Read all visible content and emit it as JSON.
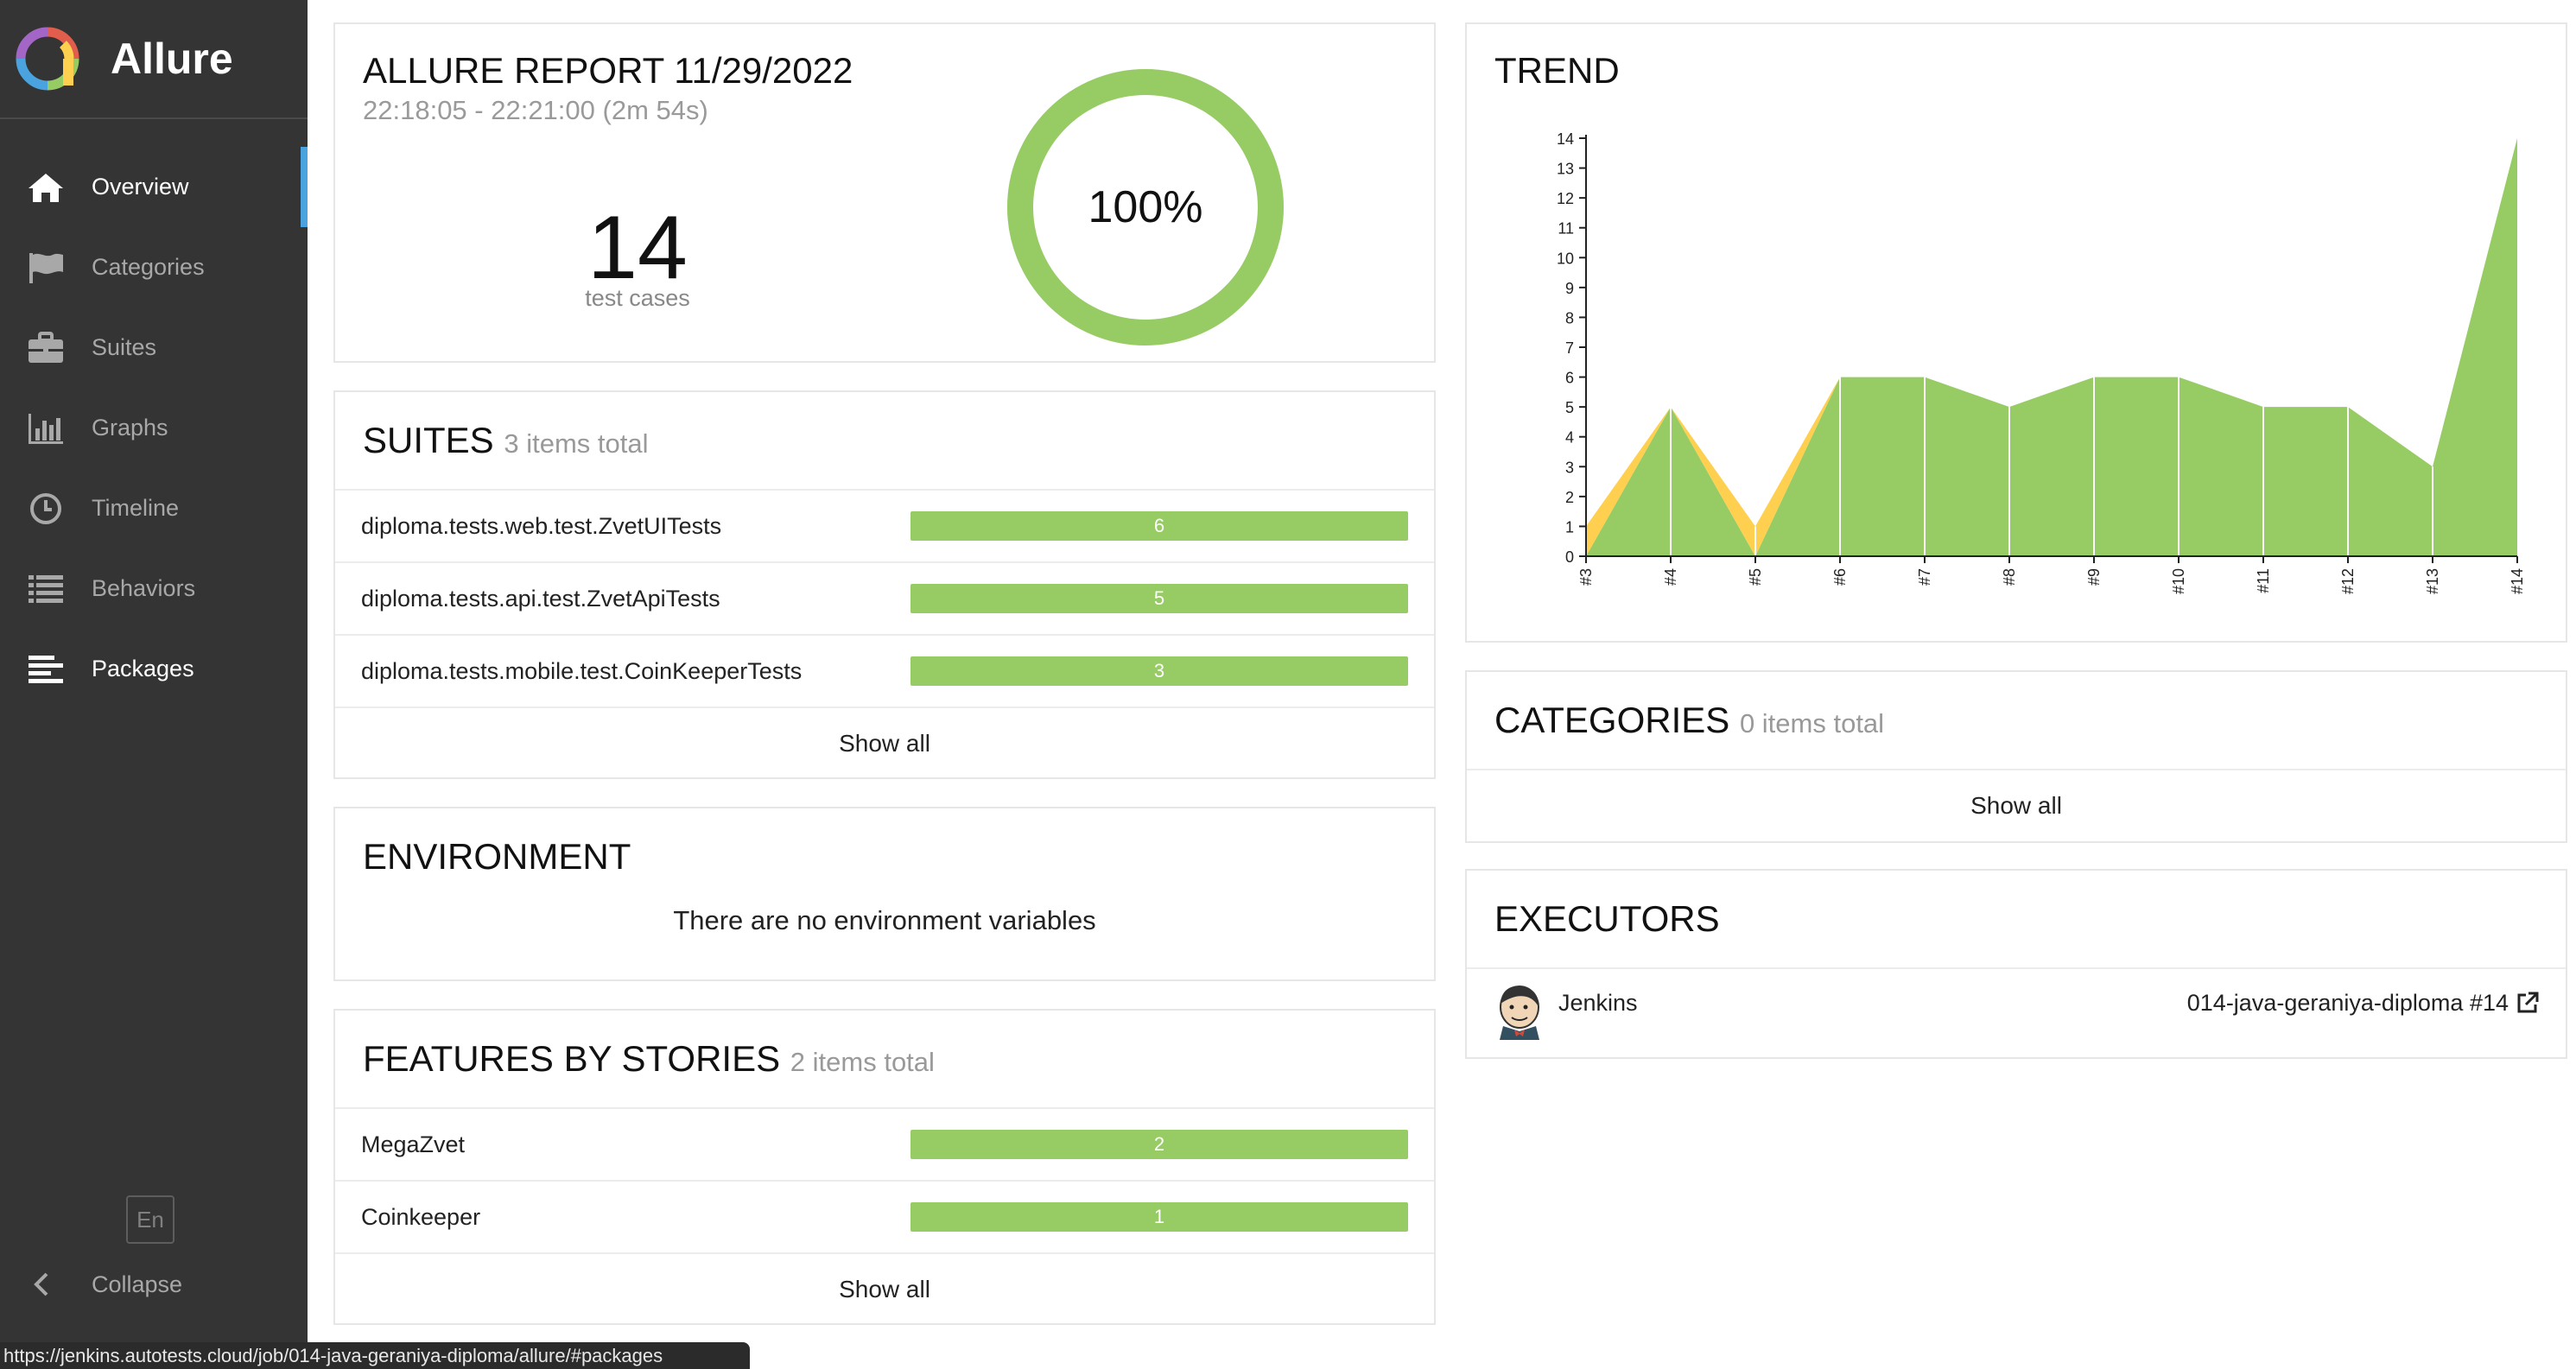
{
  "sidebar": {
    "brand": "Allure",
    "items": [
      {
        "label": "Overview",
        "icon": "home-icon"
      },
      {
        "label": "Categories",
        "icon": "flag-icon"
      },
      {
        "label": "Suites",
        "icon": "briefcase-icon"
      },
      {
        "label": "Graphs",
        "icon": "bar-chart-icon"
      },
      {
        "label": "Timeline",
        "icon": "clock-icon"
      },
      {
        "label": "Behaviors",
        "icon": "list-icon"
      },
      {
        "label": "Packages",
        "icon": "align-left-icon"
      }
    ],
    "language": "En",
    "collapse_label": "Collapse"
  },
  "summary": {
    "title": "ALLURE REPORT 11/29/2022",
    "time": "22:18:05 - 22:21:00 (2m 54s)",
    "count": "14",
    "count_label": "test cases",
    "percent": "100%",
    "passed_fraction": 1.0
  },
  "suites": {
    "title": "SUITES",
    "subtitle": "3 items total",
    "items": [
      {
        "name": "diploma.tests.web.test.ZvetUITests",
        "count": "6"
      },
      {
        "name": "diploma.tests.api.test.ZvetApiTests",
        "count": "5"
      },
      {
        "name": "diploma.tests.mobile.test.CoinKeeperTests",
        "count": "3"
      }
    ],
    "show_all": "Show all"
  },
  "environment": {
    "title": "ENVIRONMENT",
    "message": "There are no environment variables"
  },
  "features": {
    "title": "FEATURES BY STORIES",
    "subtitle": "2 items total",
    "items": [
      {
        "name": "MegaZvet",
        "count": "2"
      },
      {
        "name": "Coinkeeper",
        "count": "1"
      }
    ],
    "show_all": "Show all"
  },
  "trend": {
    "title": "TREND"
  },
  "chart_data": {
    "type": "area",
    "title": "",
    "x": [
      "#3",
      "#4",
      "#5",
      "#6",
      "#7",
      "#8",
      "#9",
      "#10",
      "#11",
      "#12",
      "#13",
      "#14"
    ],
    "series": [
      {
        "values": [
          0,
          5,
          0,
          6,
          6,
          5,
          6,
          6,
          5,
          5,
          3,
          14
        ],
        "color": "#97cc64"
      },
      {
        "values": [
          1,
          0,
          1,
          0,
          0,
          0,
          0,
          0,
          0,
          0,
          0,
          0
        ],
        "color": "#ffd050"
      }
    ],
    "stacked": true,
    "ylim": [
      0,
      14
    ],
    "yticks": [
      0,
      1,
      2,
      3,
      4,
      5,
      6,
      7,
      8,
      9,
      10,
      11,
      12,
      13,
      14
    ],
    "grid": false
  },
  "categories": {
    "title": "CATEGORIES",
    "subtitle": "0 items total",
    "show_all": "Show all"
  },
  "executors": {
    "title": "EXECUTORS",
    "name": "Jenkins",
    "build": "014-java-geraniya-diploma #14"
  },
  "status_url": "https://jenkins.autotests.cloud/job/014-java-geraniya-diploma/allure/#packages",
  "colors": {
    "sidebar_bg": "#343434",
    "passed": "#97cc64",
    "broken": "#ffd050",
    "active_marker": "#4aa3df"
  }
}
